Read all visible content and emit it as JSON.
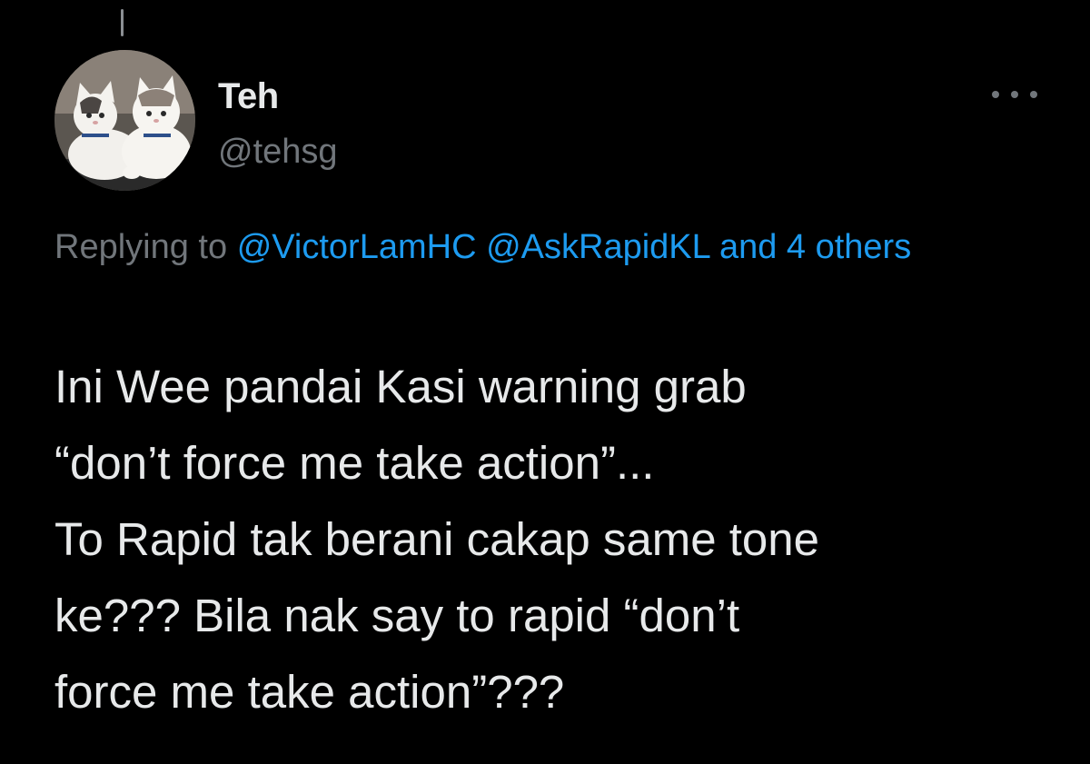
{
  "author": {
    "display_name": "Teh",
    "handle": "@tehsg",
    "avatar_icon": "two-cats-avatar"
  },
  "more_icon": "more-options-icon",
  "reply_context": {
    "prefix": "Replying to",
    "mentions": [
      "@VictorLamHC",
      "@AskRapidKL"
    ],
    "others": "and 4 others"
  },
  "tweet": {
    "lines": [
      "Ini Wee pandai Kasi warning grab",
      "“don’t force me take action”...",
      "To Rapid tak berani cakap same tone",
      "ke??? Bila nak say to rapid “don’t",
      "force me take action”???"
    ]
  },
  "colors": {
    "background": "#000000",
    "primary_text": "#e7e9ea",
    "secondary_text": "#71767b",
    "link": "#1d9bf0"
  }
}
